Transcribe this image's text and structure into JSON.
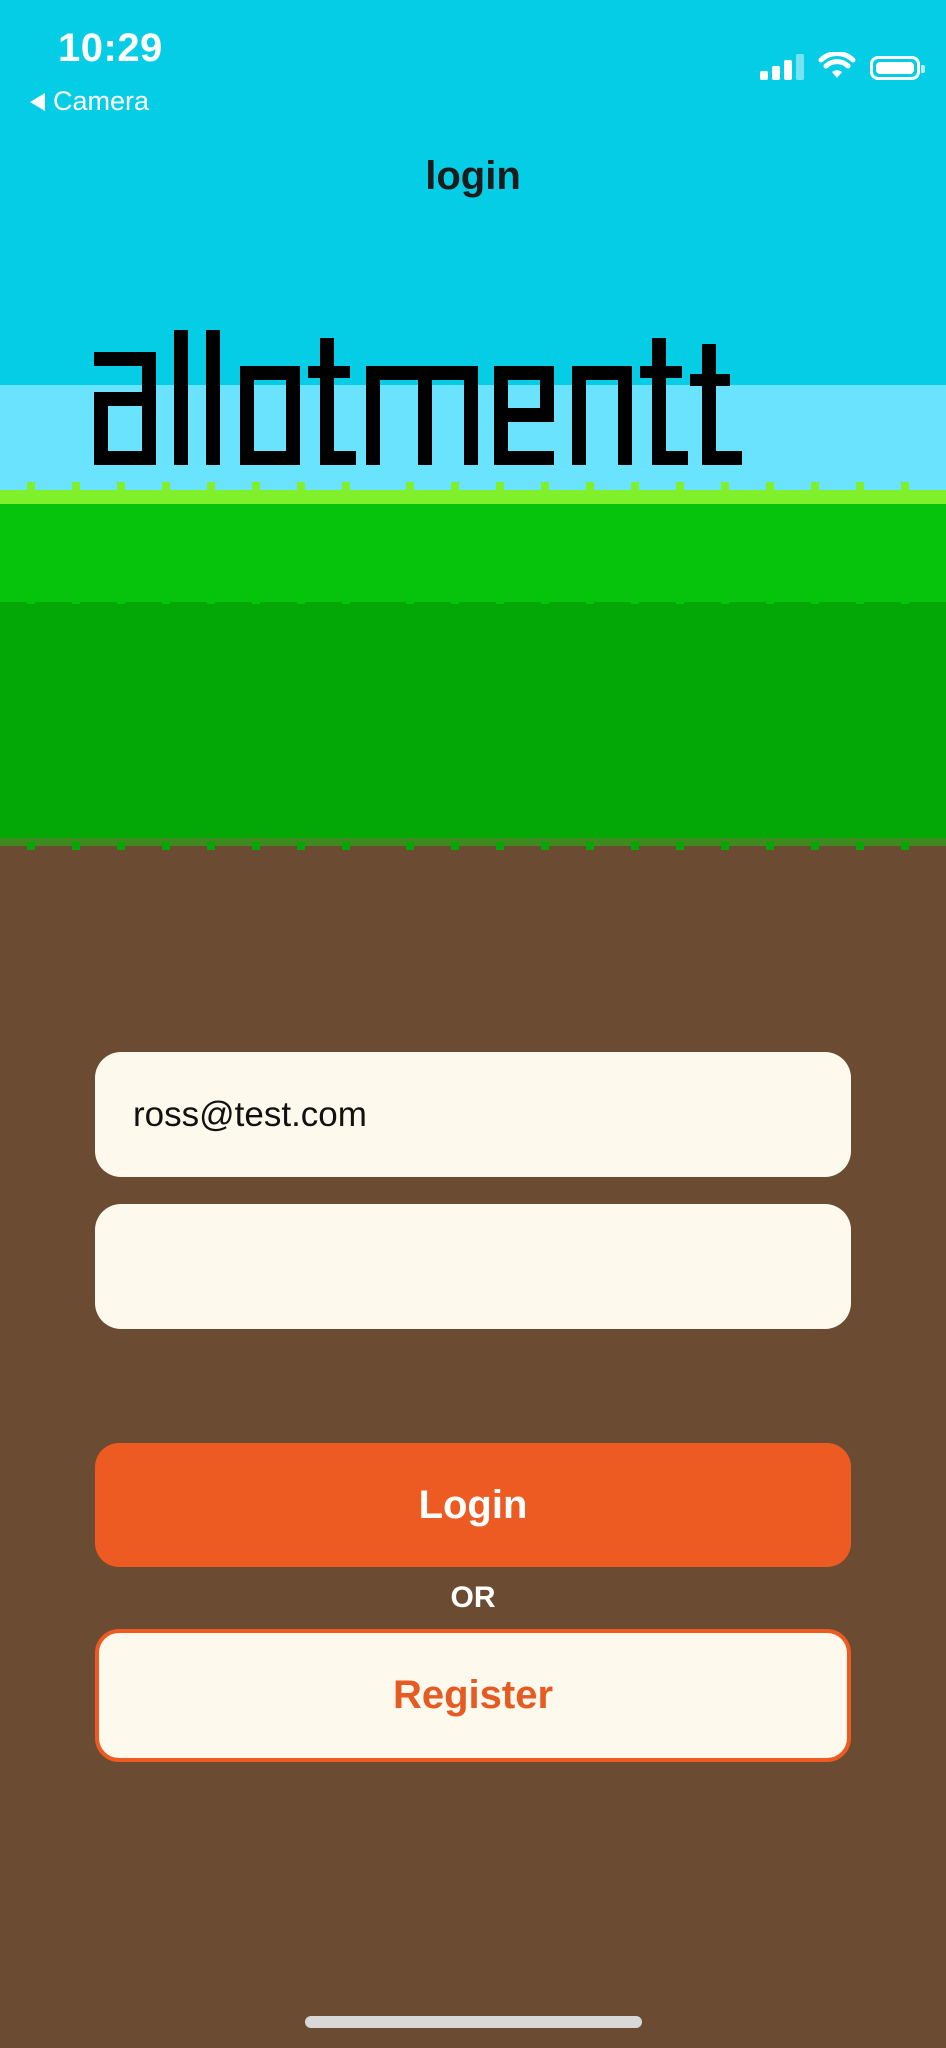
{
  "status_bar": {
    "time": "10:29",
    "back_app_label": "Camera",
    "icons": [
      "cellular-signal-icon",
      "wifi-icon",
      "battery-icon"
    ]
  },
  "header": {
    "title": "login"
  },
  "logo": {
    "text": "allotment"
  },
  "form": {
    "email_value": "ross@test.com",
    "password_value": ""
  },
  "actions": {
    "login_label": "Login",
    "or_label": "OR",
    "register_label": "Register"
  },
  "colors": {
    "sky": "#06cde6",
    "grass": "#04a806",
    "dirt": "#6b4c33",
    "accent": "#ee5b22",
    "field_background": "#fdf9ec"
  }
}
